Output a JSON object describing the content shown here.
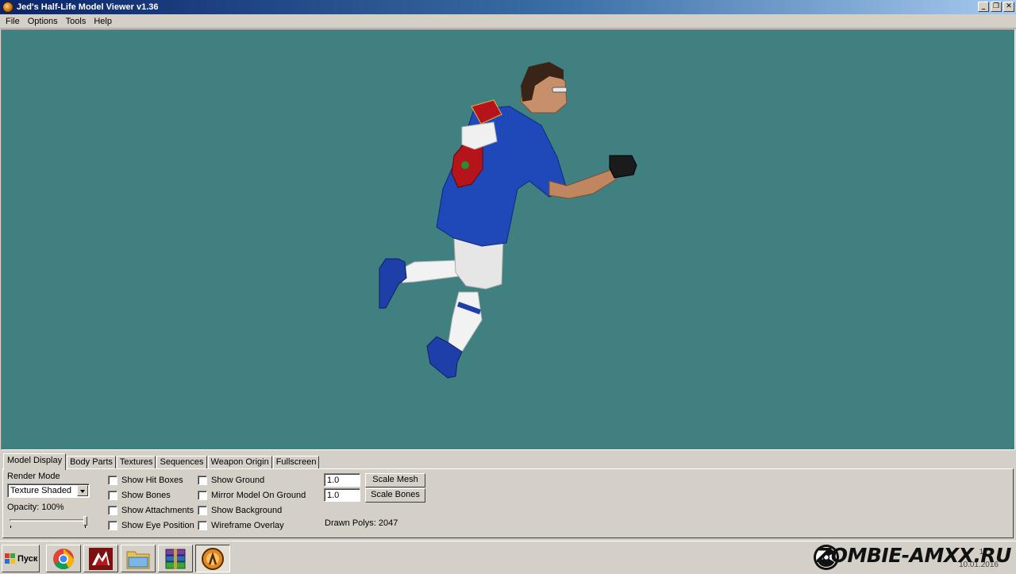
{
  "window": {
    "title": "Jed's Half-Life Model Viewer v1.36",
    "controls": {
      "minimize": "_",
      "restore": "❐",
      "close": "✕"
    }
  },
  "menu": [
    "File",
    "Options",
    "Tools",
    "Help"
  ],
  "viewport": {
    "background_color": "#418080"
  },
  "tabs": [
    {
      "label": "Model Display",
      "active": true
    },
    {
      "label": "Body Parts",
      "active": false
    },
    {
      "label": "Textures",
      "active": false
    },
    {
      "label": "Sequences",
      "active": false
    },
    {
      "label": "Weapon Origin",
      "active": false
    },
    {
      "label": "Fullscreen",
      "active": false
    }
  ],
  "model_display": {
    "render_mode_label": "Render Mode",
    "render_mode_value": "Texture Shaded",
    "opacity_label": "Opacity: 100%",
    "opacity_value": 1.0,
    "checkboxes_col1": [
      {
        "label": "Show Hit Boxes",
        "checked": false
      },
      {
        "label": "Show Bones",
        "checked": false
      },
      {
        "label": "Show Attachments",
        "checked": false
      },
      {
        "label": "Show Eye Position",
        "checked": false
      }
    ],
    "checkboxes_col2": [
      {
        "label": "Show Ground",
        "checked": false
      },
      {
        "label": "Mirror Model On Ground",
        "checked": false
      },
      {
        "label": "Show Background",
        "checked": false
      },
      {
        "label": "Wireframe Overlay",
        "checked": false
      }
    ],
    "scale_mesh_value": "1.0",
    "scale_mesh_button": "Scale Mesh",
    "scale_bones_value": "1.0",
    "scale_bones_button": "Scale Bones",
    "drawn_polys": "Drawn Polys: 2047"
  },
  "taskbar": {
    "start_label": "Пуск",
    "apps": [
      {
        "icon": "chrome-icon",
        "active": false
      },
      {
        "icon": "game-launcher-icon",
        "active": false
      },
      {
        "icon": "folder-icon",
        "active": false
      },
      {
        "icon": "winrar-icon",
        "active": false
      },
      {
        "icon": "half-life-icon",
        "active": true
      }
    ],
    "watermark": "ZOMBIE-AMXX.RU",
    "clock_time": "11",
    "clock_date": "10.01.2016"
  }
}
